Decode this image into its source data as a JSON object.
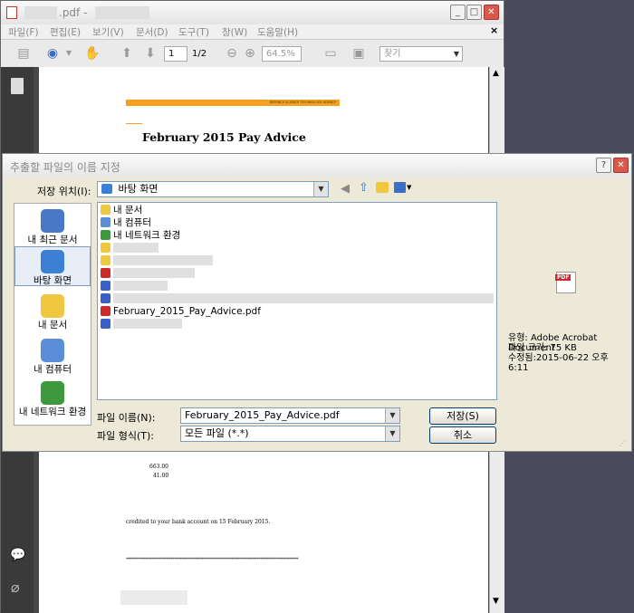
{
  "pdf_window": {
    "title": ".pdf -",
    "menu": [
      "파일(F)",
      "편집(E)",
      "보기(V)",
      "문서(D)",
      "도구(T)",
      "창(W)",
      "도움말(H)"
    ],
    "toolbar": {
      "page_current": "1",
      "page_total": "1/2",
      "zoom": "64.5%",
      "find_placeholder": "찾기"
    },
    "document": {
      "banner_text": "DEFENCE SCIENCE TECHNOLOGY AGENCY",
      "heading": "February 2015 Pay Advice",
      "amount1": "663.00",
      "amount2": "41.00",
      "credited_text": "credited to your bank account on 15 February 2015.",
      "stars": "****************************************************************************************************"
    }
  },
  "dialog": {
    "title": "추출할 파일의 이름 지정",
    "save_in_label": "저장 위치(I):",
    "save_in_value": "바탕 화면",
    "places": [
      {
        "label": "내 최근 문서",
        "icon": "recent-documents-icon",
        "color": "#4a78c8"
      },
      {
        "label": "바탕 화면",
        "icon": "desktop-icon",
        "color": "#3d7fd6"
      },
      {
        "label": "내 문서",
        "icon": "my-documents-icon",
        "color": "#f0c840"
      },
      {
        "label": "내 컴퓨터",
        "icon": "my-computer-icon",
        "color": "#5a8fd8"
      },
      {
        "label": "내 네트워크 환경",
        "icon": "network-icon",
        "color": "#3c9a3c"
      }
    ],
    "files": [
      {
        "name": "내 문서",
        "icon": "folder-documents-icon",
        "color": "#f0c840"
      },
      {
        "name": "내 컴퓨터",
        "icon": "computer-icon",
        "color": "#5a8fd8"
      },
      {
        "name": "내 네트워크 환경",
        "icon": "network-icon",
        "color": "#3c9a3c"
      },
      {
        "name": "",
        "icon": "folder-icon",
        "color": "#f0c840"
      },
      {
        "name": "",
        "icon": "folder-icon",
        "color": "#f0c840"
      },
      {
        "name": "",
        "icon": "pdf-icon",
        "color": "#cc2a2a"
      },
      {
        "name": "",
        "icon": "zip-icon",
        "color": "#3a5fc8"
      },
      {
        "name": "",
        "icon": "zip-icon",
        "color": "#3a5fc8"
      },
      {
        "name": "February_2015_Pay_Advice.pdf",
        "icon": "pdf-icon",
        "color": "#cc2a2a"
      },
      {
        "name": "",
        "icon": "zip-icon",
        "color": "#3a5fc8"
      }
    ],
    "filename_label": "파일 이름(N):",
    "filename_value": "February_2015_Pay_Advice.pdf",
    "filetype_label": "파일 형식(T):",
    "filetype_value": "모든 파일 (*.*)",
    "save_button": "저장(S)",
    "cancel_button": "취소",
    "preview": {
      "icon_label": "PDF",
      "type": "유형: Adobe Acrobat Document",
      "size": "파일 크기: 75 KB",
      "modified": "수정됨:2015-06-22 오후 6:11"
    }
  }
}
